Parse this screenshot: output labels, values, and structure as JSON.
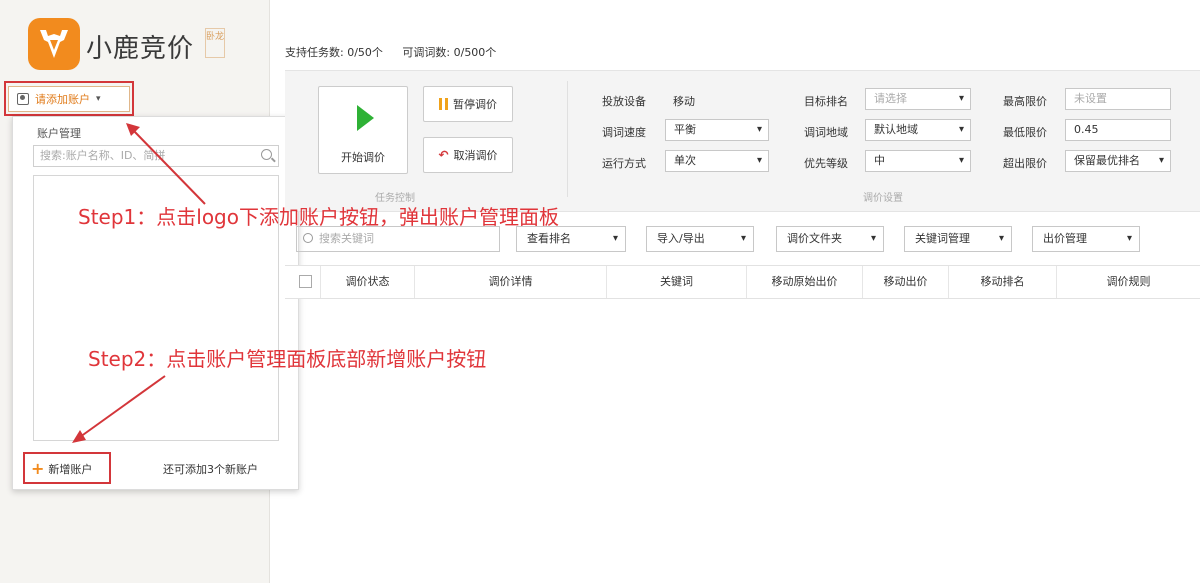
{
  "sidebar": {
    "brand": "小鹿竞价",
    "edition": "卧龙",
    "add_account_label": "请添加账户"
  },
  "account_panel": {
    "title": "账户管理",
    "search_placeholder": "搜索:账户名称、ID、简拼",
    "new_account_label": "新增账户",
    "remaining_text": "还可添加3个新账户"
  },
  "task_info": {
    "supported_tasks": "支持任务数: 0/50个",
    "bid_words": "可调词数: 0/500个"
  },
  "task_control": {
    "start_label": "开始调价",
    "pause_label": "暂停调价",
    "cancel_label": "取消调价",
    "section_label": "任务控制"
  },
  "bid_settings": {
    "section_label": "调价设置",
    "device_label": "投放设备",
    "device_value": "移动",
    "speed_label": "调词速度",
    "speed_value": "平衡",
    "mode_label": "运行方式",
    "mode_value": "单次",
    "target_rank_label": "目标排名",
    "target_rank_placeholder": "请选择",
    "region_label": "调词地域",
    "region_value": "默认地域",
    "priority_label": "优先等级",
    "priority_value": "中",
    "max_price_label": "最高限价",
    "max_price_placeholder": "未设置",
    "min_price_label": "最低限价",
    "min_price_value": "0.45",
    "over_limit_label": "超出限价",
    "over_limit_value": "保留最优排名"
  },
  "filters": {
    "search_placeholder": "搜索关键词",
    "view_rank": "查看排名",
    "import_export": "导入/导出",
    "bid_folder": "调价文件夹",
    "keyword_mgmt": "关键词管理",
    "bid_mgmt": "出价管理"
  },
  "table": {
    "columns": [
      "调价状态",
      "调价详情",
      "关键词",
      "移动原始出价",
      "移动出价",
      "移动排名",
      "调价规则"
    ]
  },
  "annotations": {
    "step1": "Step1：点击logo下添加账户按钮，弹出账户管理面板",
    "step2": "Step2：点击账户管理面板底部新增账户按钮"
  },
  "colors": {
    "brand_orange": "#f28b1e",
    "annotation_red": "#d3363a",
    "play_green": "#2eb135"
  }
}
